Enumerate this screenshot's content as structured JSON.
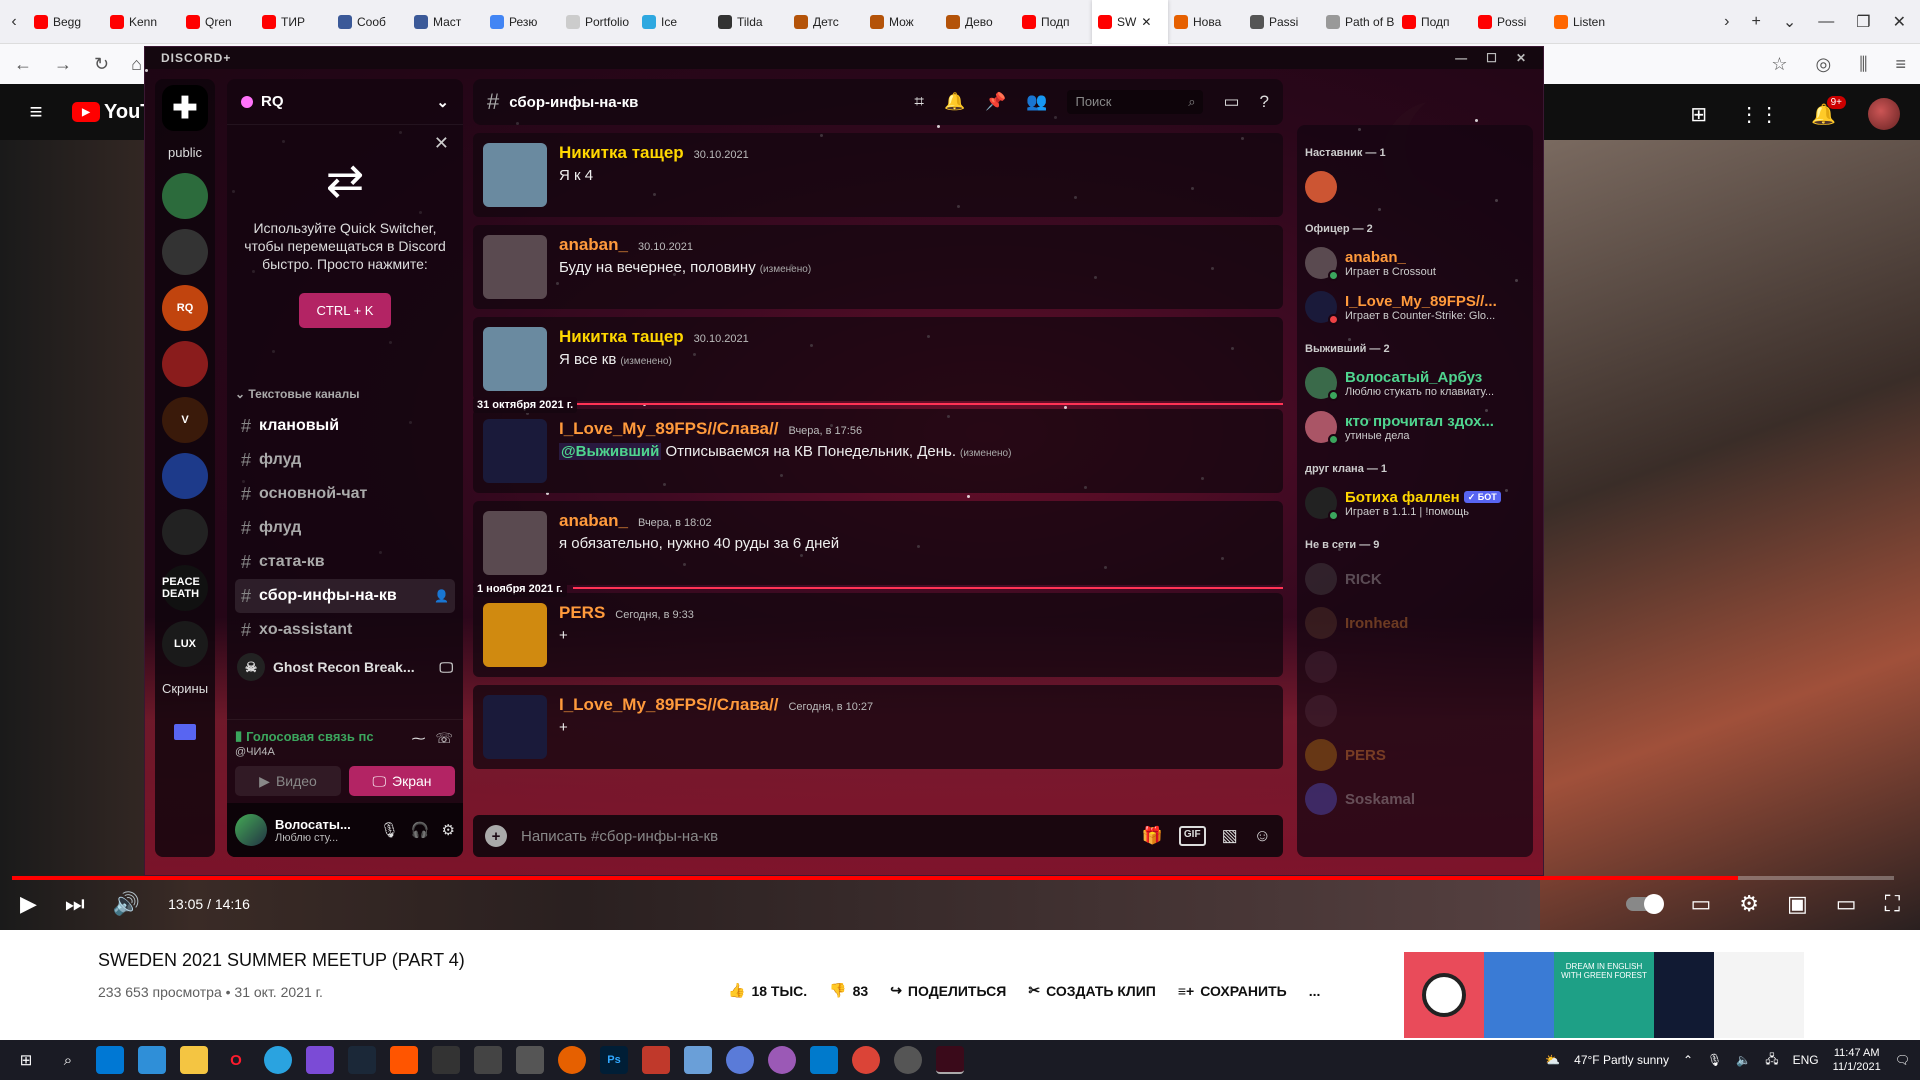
{
  "browser": {
    "tabs": [
      {
        "label": "Begg",
        "color": "#ff0000"
      },
      {
        "label": "Kenn",
        "color": "#ff0000"
      },
      {
        "label": "Qren",
        "color": "#ff0000"
      },
      {
        "label": "ТИР",
        "color": "#ff0000"
      },
      {
        "label": "Сооб",
        "color": "#3b5998"
      },
      {
        "label": "Маст",
        "color": "#3b5998"
      },
      {
        "label": "Резю",
        "color": "#4285f4"
      },
      {
        "label": "Portfolio",
        "color": "#cccccc"
      },
      {
        "label": "Ice",
        "color": "#2ea8e0"
      },
      {
        "label": "Tilda",
        "color": "#333333"
      },
      {
        "label": "Детс",
        "color": "#b45309"
      },
      {
        "label": "Мож",
        "color": "#b45309"
      },
      {
        "label": "Дево",
        "color": "#b45309"
      },
      {
        "label": "Подп",
        "color": "#ff0000"
      },
      {
        "label": "SW",
        "color": "#ff0000"
      },
      {
        "label": "Нова",
        "color": "#e66000"
      },
      {
        "label": "Passi",
        "color": "#555555"
      },
      {
        "label": "Path of B",
        "color": "#999999"
      },
      {
        "label": "Подп",
        "color": "#ff0000"
      },
      {
        "label": "Possi",
        "color": "#ff0000"
      },
      {
        "label": "Listen",
        "color": "#ff6600"
      }
    ]
  },
  "youtube": {
    "logo": "YouTube",
    "notif_count": "9+",
    "time": "13:05 / 14:16",
    "progress_fraction": 0.917,
    "title": "SWEDEN 2021 SUMMER MEETUP (PART 4)",
    "meta": "233 653 просмотра • 31 окт. 2021 г.",
    "likes": "18 ТЫС.",
    "dislikes": "83",
    "share": "ПОДЕЛИТЬСЯ",
    "clip": "СОЗДАТЬ КЛИП",
    "save": "СОХРАНИТЬ",
    "more": "...",
    "ad_text": "DREAM IN ENGLISH WITH GREEN FOREST"
  },
  "discord": {
    "app_title": "DISCORD+",
    "guilds": [
      {
        "label": "public",
        "kind": "text"
      },
      {
        "label": "",
        "color": "#2c6b3c"
      },
      {
        "label": "",
        "color": "#333333"
      },
      {
        "label": "RQ",
        "color": "#c1440e"
      },
      {
        "label": "",
        "color": "#8a1c1c"
      },
      {
        "label": "V",
        "color": "#3a1a0a"
      },
      {
        "label": "",
        "color": "#1d3a8a"
      },
      {
        "label": "",
        "color": "#222222"
      },
      {
        "label": "PEACE DEATH",
        "color": "#111111"
      },
      {
        "label": "LUX",
        "color": "#1a1a1a"
      },
      {
        "label": "Скрины",
        "kind": "text"
      }
    ],
    "server_name": "RQ",
    "quick_switcher": {
      "text": "Используйте Quick Switcher, чтобы перемещаться в Discord быстро. Просто нажмите:",
      "button": "CTRL + K"
    },
    "category": "Текстовые каналы",
    "channels": [
      {
        "name": "клановый",
        "unread": true
      },
      {
        "name": "флуд",
        "unread": false
      },
      {
        "name": "основной-чат",
        "unread": false
      },
      {
        "name": "флуд",
        "unread": false
      },
      {
        "name": "стата-кв",
        "unread": false
      },
      {
        "name": "сбор-инфы-на-кв",
        "selected": true
      },
      {
        "name": "xo-assistant",
        "unread": false
      }
    ],
    "voice_channel": "Ghost Recon Break...",
    "voice": {
      "status": "Голосовая связь пс",
      "sub": "@ЧИ4А",
      "video_btn": "Видео",
      "screen_btn": "Экран"
    },
    "user": {
      "name": "Волосаты...",
      "status": "Люблю сту..."
    },
    "current_channel": "сбор-инфы-на-кв",
    "search_placeholder": "Поиск",
    "messages": [
      {
        "user": "Никитка тащер",
        "color": "#ffd700",
        "time": "30.10.2021",
        "text": "Я к 4",
        "edited": "",
        "av": "#6a8aa0"
      },
      {
        "user": "anaban_",
        "color": "#ff9a3c",
        "time": "30.10.2021",
        "text": "Буду на вечернее, половину",
        "edited": "(изменено)",
        "av": "#5a4a50"
      },
      {
        "user": "Никитка тащер",
        "color": "#ffd700",
        "time": "30.10.2021",
        "text": "Я все кв",
        "edited": "(изменено)",
        "av": "#6a8aa0",
        "divider": "31 октября 2021 г."
      },
      {
        "user": "I_Love_My_89FPS//Слава//",
        "color": "#ff9a3c",
        "time": "Вчера, в 17:56",
        "mention": "@Выживший",
        "text": "Отписываемся на КВ Понедельник, День.",
        "edited": "(изменено)",
        "av": "#1a1a3a"
      },
      {
        "user": "anaban_",
        "color": "#ff9a3c",
        "time": "Вчера, в 18:02",
        "text": "я обязательно, нужно 40 руды за 6 дней",
        "edited": "",
        "av": "#5a4a50",
        "divider": "1 ноября 2021 г."
      },
      {
        "user": "PERS",
        "color": "#ff9a3c",
        "time": "Сегодня, в 9:33",
        "text": "+",
        "edited": "",
        "av": "#d08a10"
      },
      {
        "user": "I_Love_My_89FPS//Слава//",
        "color": "#ff9a3c",
        "time": "Сегодня, в 10:27",
        "text": "+",
        "edited": "",
        "av": "#1a1a3a"
      }
    ],
    "composer_placeholder": "Написать #сбор-инфы-на-кв",
    "gif_label": "GIF",
    "member_groups": [
      {
        "title": "Наставник — 1",
        "members": [
          {
            "name": "",
            "activity": "",
            "color": "#ffffff",
            "av": "#cc5533",
            "status": ""
          }
        ]
      },
      {
        "title": "Офицер — 2",
        "members": [
          {
            "name": "anaban_",
            "activity": "Играет в Crossout",
            "color": "#ff9a3c",
            "av": "#5a4a50",
            "status": "#3ba55d"
          },
          {
            "name": "I_Love_My_89FPS//...",
            "activity": "Играет в Counter-Strike: Glo...",
            "color": "#ff9a3c",
            "av": "#1a1a3a",
            "status": "#ed4245"
          }
        ]
      },
      {
        "title": "Выживший — 2",
        "members": [
          {
            "name": "Волосатый_Арбуз",
            "activity": "Люблю стукать по клавиату...",
            "color": "#4fd58f",
            "av": "#3a6a4a",
            "status": "#3ba55d"
          },
          {
            "name": "кто прочитал здох...",
            "activity": "утиные дела",
            "color": "#4fd58f",
            "av": "#aa5566",
            "status": "#3ba55d"
          }
        ]
      },
      {
        "title": "друг клана — 1",
        "members": [
          {
            "name": "Ботиха фаллен",
            "activity": "Играет в 1.1.1 | !помощь",
            "color": "#ffd700",
            "av": "#222222",
            "status": "#3ba55d",
            "bot": "✓ БОТ"
          }
        ]
      },
      {
        "title": "Не в сети — 9",
        "members": [
          {
            "name": "RICK",
            "activity": "",
            "color": "#cccccc",
            "av": "#555555",
            "offline": true
          },
          {
            "name": "Ironhead",
            "activity": "",
            "color": "#ff9a3c",
            "av": "#664433",
            "offline": true
          },
          {
            "name": "",
            "activity": "",
            "color": "#cccccc",
            "av": "#553344",
            "offline": true
          },
          {
            "name": "",
            "activity": "",
            "color": "#cccccc",
            "av": "#553344",
            "offline": true
          },
          {
            "name": "PERS",
            "activity": "",
            "color": "#ff9a3c",
            "av": "#d08a10",
            "offline": true
          },
          {
            "name": "Soskamal",
            "activity": "",
            "color": "#cccccc",
            "av": "#5865f2",
            "offline": true
          }
        ]
      }
    ]
  },
  "taskbar": {
    "weather": "47°F  Partly sunny",
    "lang": "ENG",
    "time": "11:47 AM",
    "date": "11/1/2021"
  }
}
